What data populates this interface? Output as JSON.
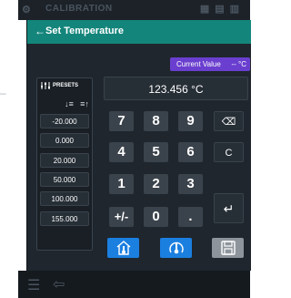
{
  "background": {
    "title": "CALIBRATION",
    "left_dash": "–"
  },
  "header": {
    "back_glyph": "←",
    "title": "Set Temperature"
  },
  "current_value": {
    "label": "Current Value",
    "value": "-- °C"
  },
  "presets": {
    "title": "PRESETS",
    "items": [
      "-20.000",
      "0.000",
      "20.000",
      "50.000",
      "100.000",
      "155.000"
    ]
  },
  "display": {
    "value": "123.456 °C"
  },
  "keypad": {
    "keys": [
      "7",
      "8",
      "9",
      "4",
      "5",
      "6",
      "1",
      "2",
      "3",
      "+/-",
      "0",
      "."
    ],
    "backspace": "⌫",
    "clear": "C",
    "enter": "↵"
  },
  "colors": {
    "header": "#14857b",
    "badge": "#6a3fcf",
    "action_blue": "#1b7fe0",
    "save_grey": "#8d949b"
  }
}
